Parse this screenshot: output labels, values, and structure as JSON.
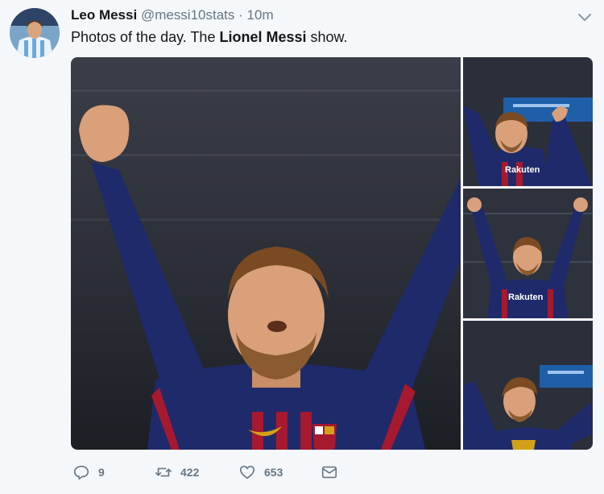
{
  "tweet": {
    "author_name": "Leo Messi",
    "handle": "@messi10stats",
    "separator": "·",
    "time": "10m",
    "text_prefix": "Photos of the day. The ",
    "text_bold": "Lionel Messi",
    "text_suffix": " show."
  },
  "media": {
    "photos": [
      {
        "name": "main-photo",
        "sponsor_text": ""
      },
      {
        "name": "photo-2",
        "sponsor_text": "Rakuten"
      },
      {
        "name": "photo-3",
        "sponsor_text": "Rakuten"
      },
      {
        "name": "photo-4",
        "sponsor_text": ""
      }
    ],
    "colors": {
      "shirt": "#1f2a6b",
      "shirt_red": "#a6192e",
      "skin": "#d9a07a",
      "hair": "#7a4a22",
      "crowd": "#3b3f4a"
    }
  },
  "actions": {
    "replies": "9",
    "retweets": "422",
    "likes": "653"
  },
  "icons": [
    "reply-icon",
    "retweet-icon",
    "heart-icon",
    "message-icon",
    "chevron-down-icon"
  ]
}
